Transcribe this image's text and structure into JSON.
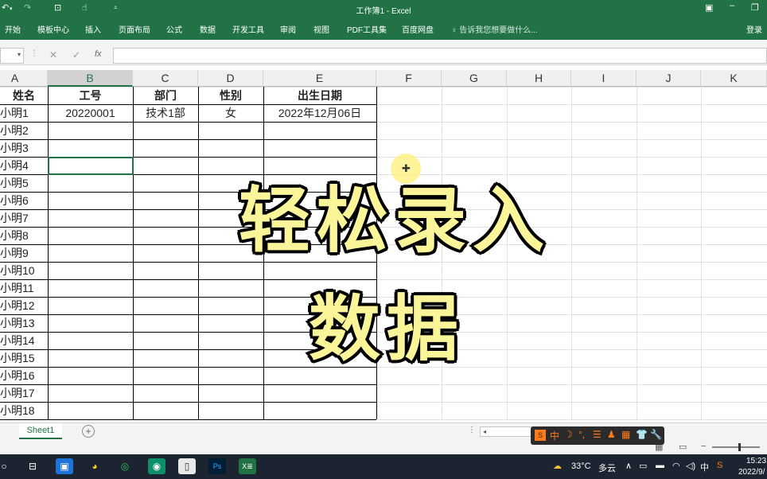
{
  "window": {
    "title": "工作簿1 - Excel"
  },
  "ribbon": {
    "tabs": [
      "开始",
      "模板中心",
      "插入",
      "页面布局",
      "公式",
      "数据",
      "开发工具",
      "审阅",
      "视图",
      "PDF工具集",
      "百度网盘"
    ],
    "tell_me": "告诉我您想要做什么...",
    "login": "登录"
  },
  "formula_bar": {
    "fx": "fx",
    "cancel": "✕",
    "enter": "✓"
  },
  "grid": {
    "columns": [
      "A",
      "B",
      "C",
      "D",
      "E",
      "F",
      "G",
      "H",
      "I",
      "J",
      "K"
    ],
    "active_column": "B",
    "header_row": [
      "姓名",
      "工号",
      "部门",
      "性别",
      "出生日期"
    ],
    "data_rows": [
      [
        "小明1",
        "20220001",
        "技术1部",
        "女",
        "2022年12月06日"
      ],
      [
        "小明2",
        "",
        "",
        "",
        ""
      ],
      [
        "小明3",
        "",
        "",
        "",
        ""
      ],
      [
        "小明4",
        "",
        "",
        "",
        ""
      ],
      [
        "小明5",
        "",
        "",
        "",
        ""
      ],
      [
        "小明6",
        "",
        "",
        "",
        ""
      ],
      [
        "小明7",
        "",
        "",
        "",
        ""
      ],
      [
        "小明8",
        "",
        "",
        "",
        ""
      ],
      [
        "小明9",
        "",
        "",
        "",
        ""
      ],
      [
        "小明10",
        "",
        "",
        "",
        ""
      ],
      [
        "小明11",
        "",
        "",
        "",
        ""
      ],
      [
        "小明12",
        "",
        "",
        "",
        ""
      ],
      [
        "小明13",
        "",
        "",
        "",
        ""
      ],
      [
        "小明14",
        "",
        "",
        "",
        ""
      ],
      [
        "小明15",
        "",
        "",
        "",
        ""
      ],
      [
        "小明16",
        "",
        "",
        "",
        ""
      ],
      [
        "小明17",
        "",
        "",
        "",
        ""
      ],
      [
        "小明18",
        "",
        "",
        "",
        ""
      ]
    ]
  },
  "overlay": {
    "line1": "轻松录入",
    "line2": "数据"
  },
  "sheets": {
    "tabs": [
      "Sheet1"
    ],
    "add": "+"
  },
  "ime": {
    "items": [
      "中",
      "☽",
      "°,",
      "☰",
      "♟",
      "▦",
      "👕",
      "🔧"
    ]
  },
  "taskbar": {
    "weather_temp": "33°C",
    "weather_desc": "多云",
    "ime_lang": "中",
    "time": "15:23",
    "date": "2022/9/"
  },
  "colors": {
    "excel_green": "#217346",
    "overlay_fill": "#fbf59a",
    "taskbar": "#1c2431"
  }
}
